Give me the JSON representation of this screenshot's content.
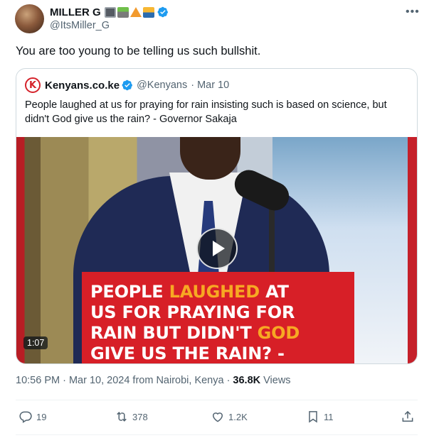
{
  "author": {
    "display_name": "MILLER G",
    "handle": "@ItsMiller_G",
    "emoji_icons": [
      "camera-icon",
      "road-icon",
      "tent-icon",
      "sunset-icon"
    ]
  },
  "tweet": {
    "text": "You are too young to be telling us such bullshit."
  },
  "quote": {
    "logo_letter": "K",
    "name": "Kenyans.co.ke",
    "handle": "@Kenyans",
    "date": "· Mar 10",
    "text": "People laughed at us for praying for rain insisting such is based on science, but didn't God give us the rain? - Governor Sakaja",
    "media": {
      "duration": "1:07",
      "banner_lines": [
        [
          "PEOPLE ",
          "LAUGHED",
          " AT"
        ],
        [
          "US FOR PRAYING FOR"
        ],
        [
          "RAIN BUT DIDN'T ",
          "GOD"
        ],
        [
          "GIVE US THE RAIN? -"
        ]
      ],
      "banner_l1_a": "PEOPLE ",
      "banner_l1_b": "LAUGHED",
      "banner_l1_c": " AT",
      "banner_l2": "US FOR PRAYING FOR",
      "banner_l3_a": "RAIN BUT DIDN'T ",
      "banner_l3_b": "GOD",
      "banner_l4": "GIVE US THE RAIN? -"
    }
  },
  "meta": {
    "timestamp": "10:56 PM · Mar 10, 2024 from Nairobi, Kenya ·",
    "views_count": "36.8K",
    "views_label": "Views"
  },
  "actions": {
    "replies": "19",
    "reposts": "378",
    "likes": "1.2K",
    "bookmarks": "11"
  },
  "colors": {
    "verified": "#1d9bf0",
    "brand_red": "#d71f27",
    "highlight": "#f7a823",
    "muted": "#536471"
  }
}
